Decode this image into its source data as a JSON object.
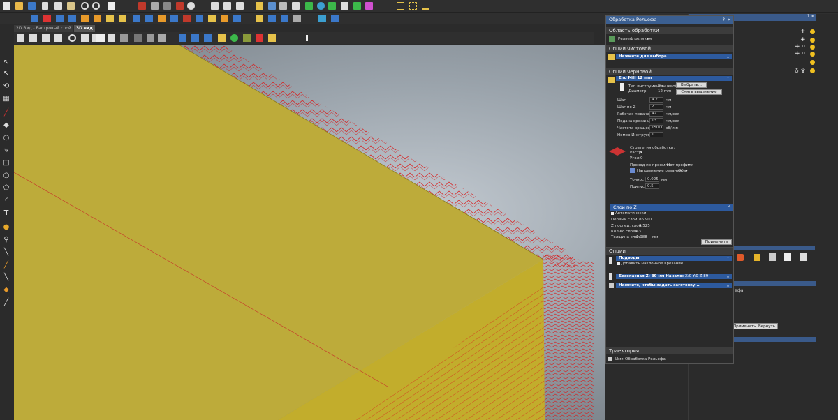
{
  "view_tabs": [
    {
      "label": "2D Вид - Растровый слой",
      "active": false
    },
    {
      "label": "3D вид",
      "active": true
    }
  ],
  "dialog": {
    "title": "Обработка Рельефа",
    "title_controls": {
      "help": "?",
      "close": "×"
    },
    "sections": {
      "region": "Область обработки",
      "finish": "Опции чистовой",
      "rough": "Опции черновой",
      "z_layers": "Слои по Z",
      "options": "Опции",
      "toolpath": "Траектория"
    },
    "region_value": "Рельеф целиком",
    "finish_prompt": "Нажмите для выбора...",
    "tool": {
      "name": "End Mill 12 mm",
      "type_label": "Тип инструмента",
      "type_value": "Концевой",
      "diameter_label": "Диаметр:",
      "diameter_value": "12 mm",
      "select_button": "Выбрать...",
      "clear_button": "Снять выделение"
    },
    "params": [
      {
        "label": "Шаг",
        "value": "4.2",
        "unit": "мм"
      },
      {
        "label": "Шаг по Z",
        "value": "2",
        "unit": "мм"
      },
      {
        "label": "Рабочая подача",
        "value": "42",
        "unit": "мм/сек"
      },
      {
        "label": "Подача врезания",
        "value": "13",
        "unit": "мм/сек"
      },
      {
        "label": "Частота вращения",
        "value": "15000",
        "unit": "об/мин"
      },
      {
        "label": "Номер Инструмента",
        "value": "1",
        "unit": ""
      }
    ],
    "strategy": {
      "label": "Стратегия обработки:",
      "value": "Растр",
      "angle_label": "Угол:",
      "angle_value": "0",
      "profile_label": "Проход по профилю:",
      "profile_value": "Нет профиля",
      "direction_label": "Направление резания:",
      "direction_value": "Оба",
      "tolerance_label": "Точность:",
      "tolerance_value": "0.025",
      "tolerance_unit": "мм",
      "allowance_label": "Припуск",
      "allowance_value": "0.5"
    },
    "z_layers": {
      "auto_label": "Автоматически",
      "first_label": "Первый слой:",
      "first_value": "86.901",
      "last_label": "Z послед. слоя:",
      "last_value": "0.525",
      "count_label": "Кол-во слоев:",
      "count_value": "43",
      "thickness_label": "Толщина слоя:",
      "thickness_value": "1.988",
      "thickness_unit": "мм",
      "apply_button": "Применить"
    },
    "options": {
      "leadin_label": "Подводы",
      "ramp_label": "Добавить наклонное врезание",
      "safez_label": "Безопасная Z:",
      "safez_value": "89",
      "safez_unit": "мм",
      "start_label": "Начало:",
      "start_value": "X:0 Y:0 Z:89",
      "stock_prompt": "Нажмите, чтобы задать заготовку..."
    },
    "toolpath": {
      "name_label": "Имя:",
      "name_value": "Обработка Рельефа"
    }
  },
  "right_panel": {
    "apply_button": "Применить",
    "return_button": "Вернуть",
    "fragment_label": "ефа"
  },
  "colors": {
    "block_top": "#bdab3a",
    "block_side": "#c2ad2c",
    "toolpath": "#d81b1b",
    "title_bar": "#3b5f91"
  }
}
